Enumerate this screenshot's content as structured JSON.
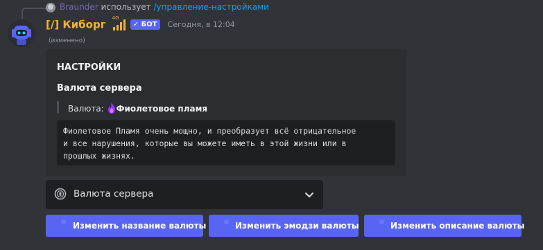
{
  "reply": {
    "user": "Braunder",
    "uses_text": "использует",
    "command": "/управление-настройками"
  },
  "message": {
    "author": "[/] Киборг",
    "signal_label": "4G",
    "bot_badge": "✓ БОТ",
    "timestamp": "Сегодня, в 12:04",
    "edited": "(изменено)"
  },
  "embed": {
    "title": "НАСТРОЙКИ",
    "field_name": "Валюта сервера",
    "currency_prefix": "Валюта:",
    "currency_name": "Фиолетовое пламя",
    "code_lines": [
      "Фиолетовое Пламя очень мощно, и преобразует всё отрицательное",
      "и все нарушения, которые вы можете иметь в этой жизни или в",
      "прошлых жизнях."
    ]
  },
  "select_menu": {
    "label": "Валюта сервера"
  },
  "buttons": {
    "rename": "Изменить название валюты",
    "emoji": "Изменить эмодзи валюты",
    "description": "Изменить описание валюты"
  },
  "colors": {
    "background": "#313338",
    "embed_bg": "#2b2d31",
    "blurple": "#5865f2",
    "author": "#f0b232",
    "command_link": "#00a8fc"
  }
}
